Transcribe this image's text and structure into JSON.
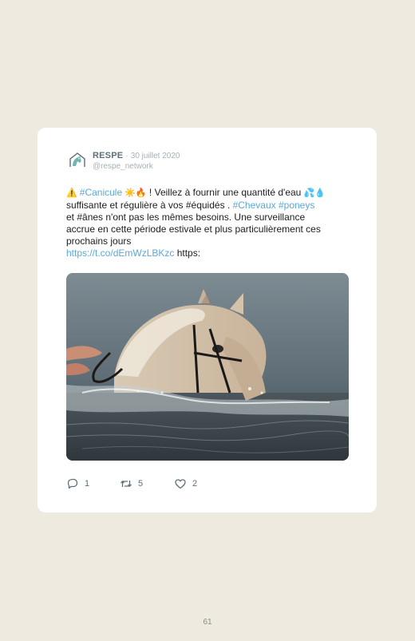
{
  "tweet": {
    "author_name": "RESPE",
    "separator": "·",
    "date": "30 juillet 2020",
    "handle": "@respe_network",
    "lines": [
      {
        "parts": [
          {
            "t": "⚠️ ",
            "c": "emoji"
          },
          {
            "t": "#Canicule",
            "c": "link"
          },
          {
            "t": " ☀️🔥",
            "c": "emoji"
          },
          {
            "t": " ! Veillez à fournir une quantité d'eau ",
            "c": "text"
          },
          {
            "t": "💦💧",
            "c": "emoji"
          }
        ]
      },
      {
        "parts": [
          {
            "t": "suffisante et régulière à vos #équidés . ",
            "c": "text"
          },
          {
            "t": "#Chevaux",
            "c": "link"
          },
          {
            "t": " ",
            "c": "text"
          },
          {
            "t": "#poneys",
            "c": "link"
          }
        ]
      },
      {
        "parts": [
          {
            "t": "et #ânes n'ont pas les mêmes besoins. Une surveillance",
            "c": "text"
          }
        ]
      },
      {
        "parts": [
          {
            "t": "accrue en cette période estivale et plus particulièrement ces",
            "c": "text"
          }
        ]
      },
      {
        "parts": [
          {
            "t": "prochains jours",
            "c": "text"
          }
        ]
      },
      {
        "parts": [
          {
            "t": "https://t.co/dEmWzLBKzc",
            "c": "link"
          },
          {
            "t": " https:",
            "c": "text"
          }
        ]
      }
    ],
    "reply_count": "1",
    "retweet_count": "5",
    "like_count": "2"
  },
  "icons": {
    "avatar": "respe-logo-icon",
    "reply": "reply-icon",
    "retweet": "retweet-icon",
    "like": "heart-icon"
  },
  "colors": {
    "background": "#efeadf",
    "card": "#ffffff",
    "link": "#5aa8d8",
    "muted": "#a6b0b6"
  },
  "page_number": "61"
}
